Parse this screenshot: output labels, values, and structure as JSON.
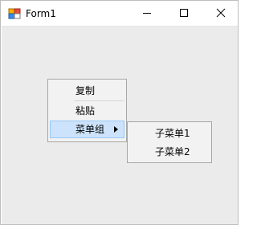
{
  "window": {
    "title": "Form1"
  },
  "icons": {
    "app": "windows-form-icon",
    "minimize": "minimize-icon",
    "maximize": "maximize-icon",
    "close": "close-icon",
    "submenu_arrow": "chevron-right-icon"
  },
  "context_menu": {
    "items": [
      {
        "label": "复制"
      },
      {
        "label": "粘贴"
      },
      {
        "label": "菜单组",
        "highlighted": true,
        "has_submenu": true
      }
    ]
  },
  "submenu": {
    "items": [
      {
        "label": "子菜单1"
      },
      {
        "label": "子菜单2"
      }
    ]
  },
  "colors": {
    "client_bg": "#ebebeb",
    "menu_bg": "#f2f2f2",
    "menu_border": "#a7a7a7",
    "highlight_bg": "#cce3fb",
    "highlight_border": "#99c9f5"
  }
}
